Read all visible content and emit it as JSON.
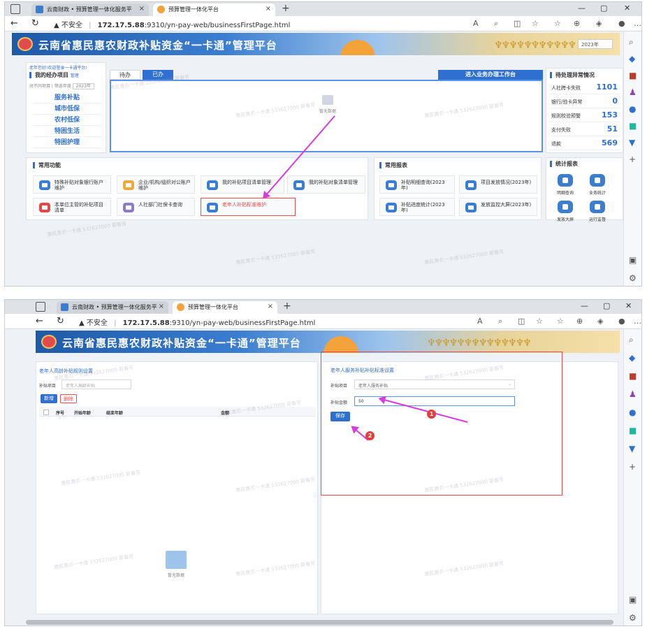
{
  "browser": {
    "tab1_title": "云南财政 • 预算管理一体化服务平",
    "tab2_title": "预算管理一体化平台",
    "insecure_label": "不安全",
    "url_host": "172.17.5.88",
    "url_rest": ":9310/yn-pay-web/businessFirstPage.html",
    "new_tab": "+"
  },
  "banner": {
    "title": "云南省惠民惠农财政补贴资金“一卡通”管理平台",
    "year": "2023年"
  },
  "home": {
    "welcome": "老年您好!欢迎登录一卡通平台!",
    "my_items_title": "我的经办项目",
    "my_items_manage": "管理",
    "filter_text": "对不同项目 | 筛选年度",
    "filter_year": "2023年",
    "my_items": [
      "服务补贴",
      "城市低保",
      "农村低保",
      "特困生活",
      "特困护理"
    ],
    "tab_pending": "待办",
    "tab_done": "已办",
    "enter_button": "进入业务办理工作台",
    "no_data": "暂无数据",
    "anomaly_title": "待处理异常情况",
    "anomalies": [
      {
        "label": "人社跨卡失败",
        "value": "1101"
      },
      {
        "label": "银行/验卡异常",
        "value": "0"
      },
      {
        "label": "规则校验预警",
        "value": "153"
      },
      {
        "label": "支付失败",
        "value": "51"
      },
      {
        "label": "退款",
        "value": "569"
      }
    ],
    "common_title": "常用功能",
    "functions": [
      "特殊补贴对象银行账户维护",
      "企业/机构/组织对公账户维护",
      "我的补贴项目清单管理",
      "我的补贴对象清单管理",
      "本单位主管的补贴项目清单",
      "人社部门社保卡查询",
      "老年人补贴标准维护"
    ],
    "reports_title": "常用报表",
    "reports": [
      "补贴明细查询(2023年)",
      "项目发放情况(2023年)",
      "补贴进度统计(2023年)",
      "发放监控大屏(2023年)"
    ],
    "stats_title": "统计报表",
    "stats": [
      "明细查询",
      "业务统计",
      "发放大屏",
      "运行监督"
    ]
  },
  "form": {
    "left_title": "老年人高龄补贴规则设置",
    "left_item_label": "补贴项目",
    "left_item_placeholder": "老年人高龄补贴",
    "add_button": "新增",
    "delete_button": "删除",
    "columns": [
      "序号",
      "开始年龄",
      "结束年龄",
      "金额"
    ],
    "no_data": "暂无数据",
    "right_title": "老年人服务补贴补贴标准设置",
    "item_label": "补贴项目",
    "item_value": "老年人服务补贴",
    "amount_label": "补贴金额",
    "amount_value": "50",
    "save_button": "保存",
    "step1": "1",
    "step2": "2"
  },
  "watermark": "惠民惠农一卡通 532627000 薪春芳",
  "colors": {
    "primary": "#2f6fd0",
    "annotation": "#d63be0",
    "highlight": "#e94c4c"
  }
}
